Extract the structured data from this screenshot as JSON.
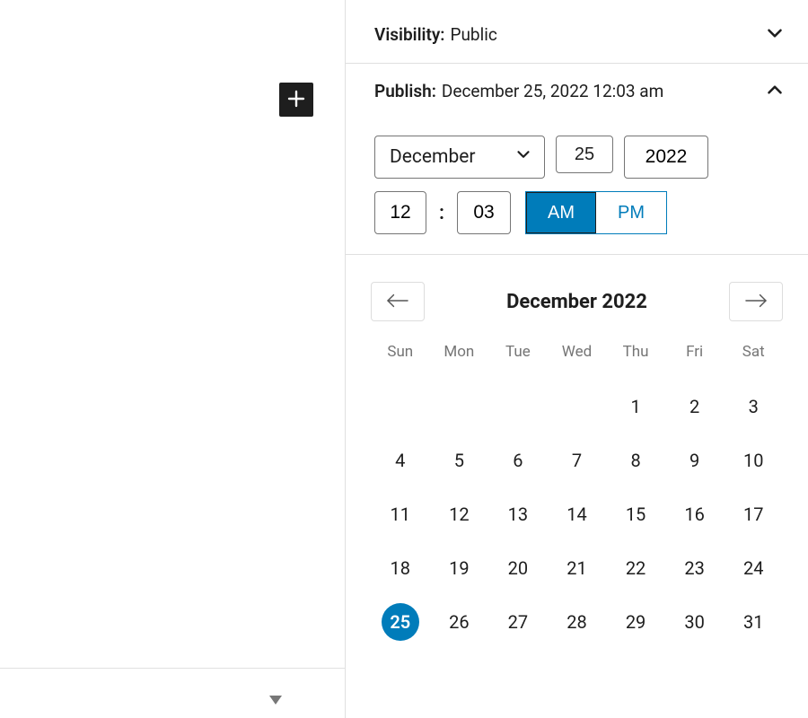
{
  "visibility": {
    "label": "Visibility:",
    "value": "Public"
  },
  "publish": {
    "label": "Publish:",
    "value": "December 25, 2022 12:03 am"
  },
  "datetime": {
    "month": "December",
    "day": "25",
    "year": "2022",
    "hour": "12",
    "minute": "03",
    "am": "AM",
    "pm": "PM",
    "meridiem_active": "AM"
  },
  "calendar": {
    "title": "December 2022",
    "dow": [
      "Sun",
      "Mon",
      "Tue",
      "Wed",
      "Thu",
      "Fri",
      "Sat"
    ],
    "leading_blanks": 4,
    "days_in_month": 31,
    "selected_day": 25
  }
}
